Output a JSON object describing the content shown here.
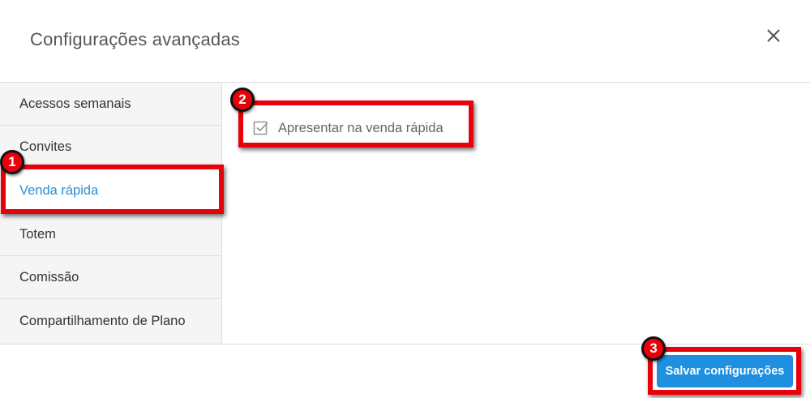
{
  "dialog": {
    "title": "Configurações avançadas",
    "close_icon": "close-icon"
  },
  "sidebar": {
    "items": [
      {
        "label": "Acessos semanais",
        "active": false
      },
      {
        "label": "Convites",
        "active": false
      },
      {
        "label": "Venda rápida",
        "active": true
      },
      {
        "label": "Totem",
        "active": false
      },
      {
        "label": "Comissão",
        "active": false
      },
      {
        "label": "Compartilhamento de Plano",
        "active": false
      }
    ]
  },
  "content": {
    "checkbox": {
      "label": "Apresentar na venda rápida",
      "checked": true
    }
  },
  "footer": {
    "save_label": "Salvar configurações"
  },
  "annotations": {
    "badges": [
      "1",
      "2",
      "3"
    ],
    "color": "#e8000b"
  },
  "colors": {
    "accent": "#1f8fe0",
    "active_text": "#2a8fd8",
    "sidebar_bg": "#f5f5f5"
  }
}
